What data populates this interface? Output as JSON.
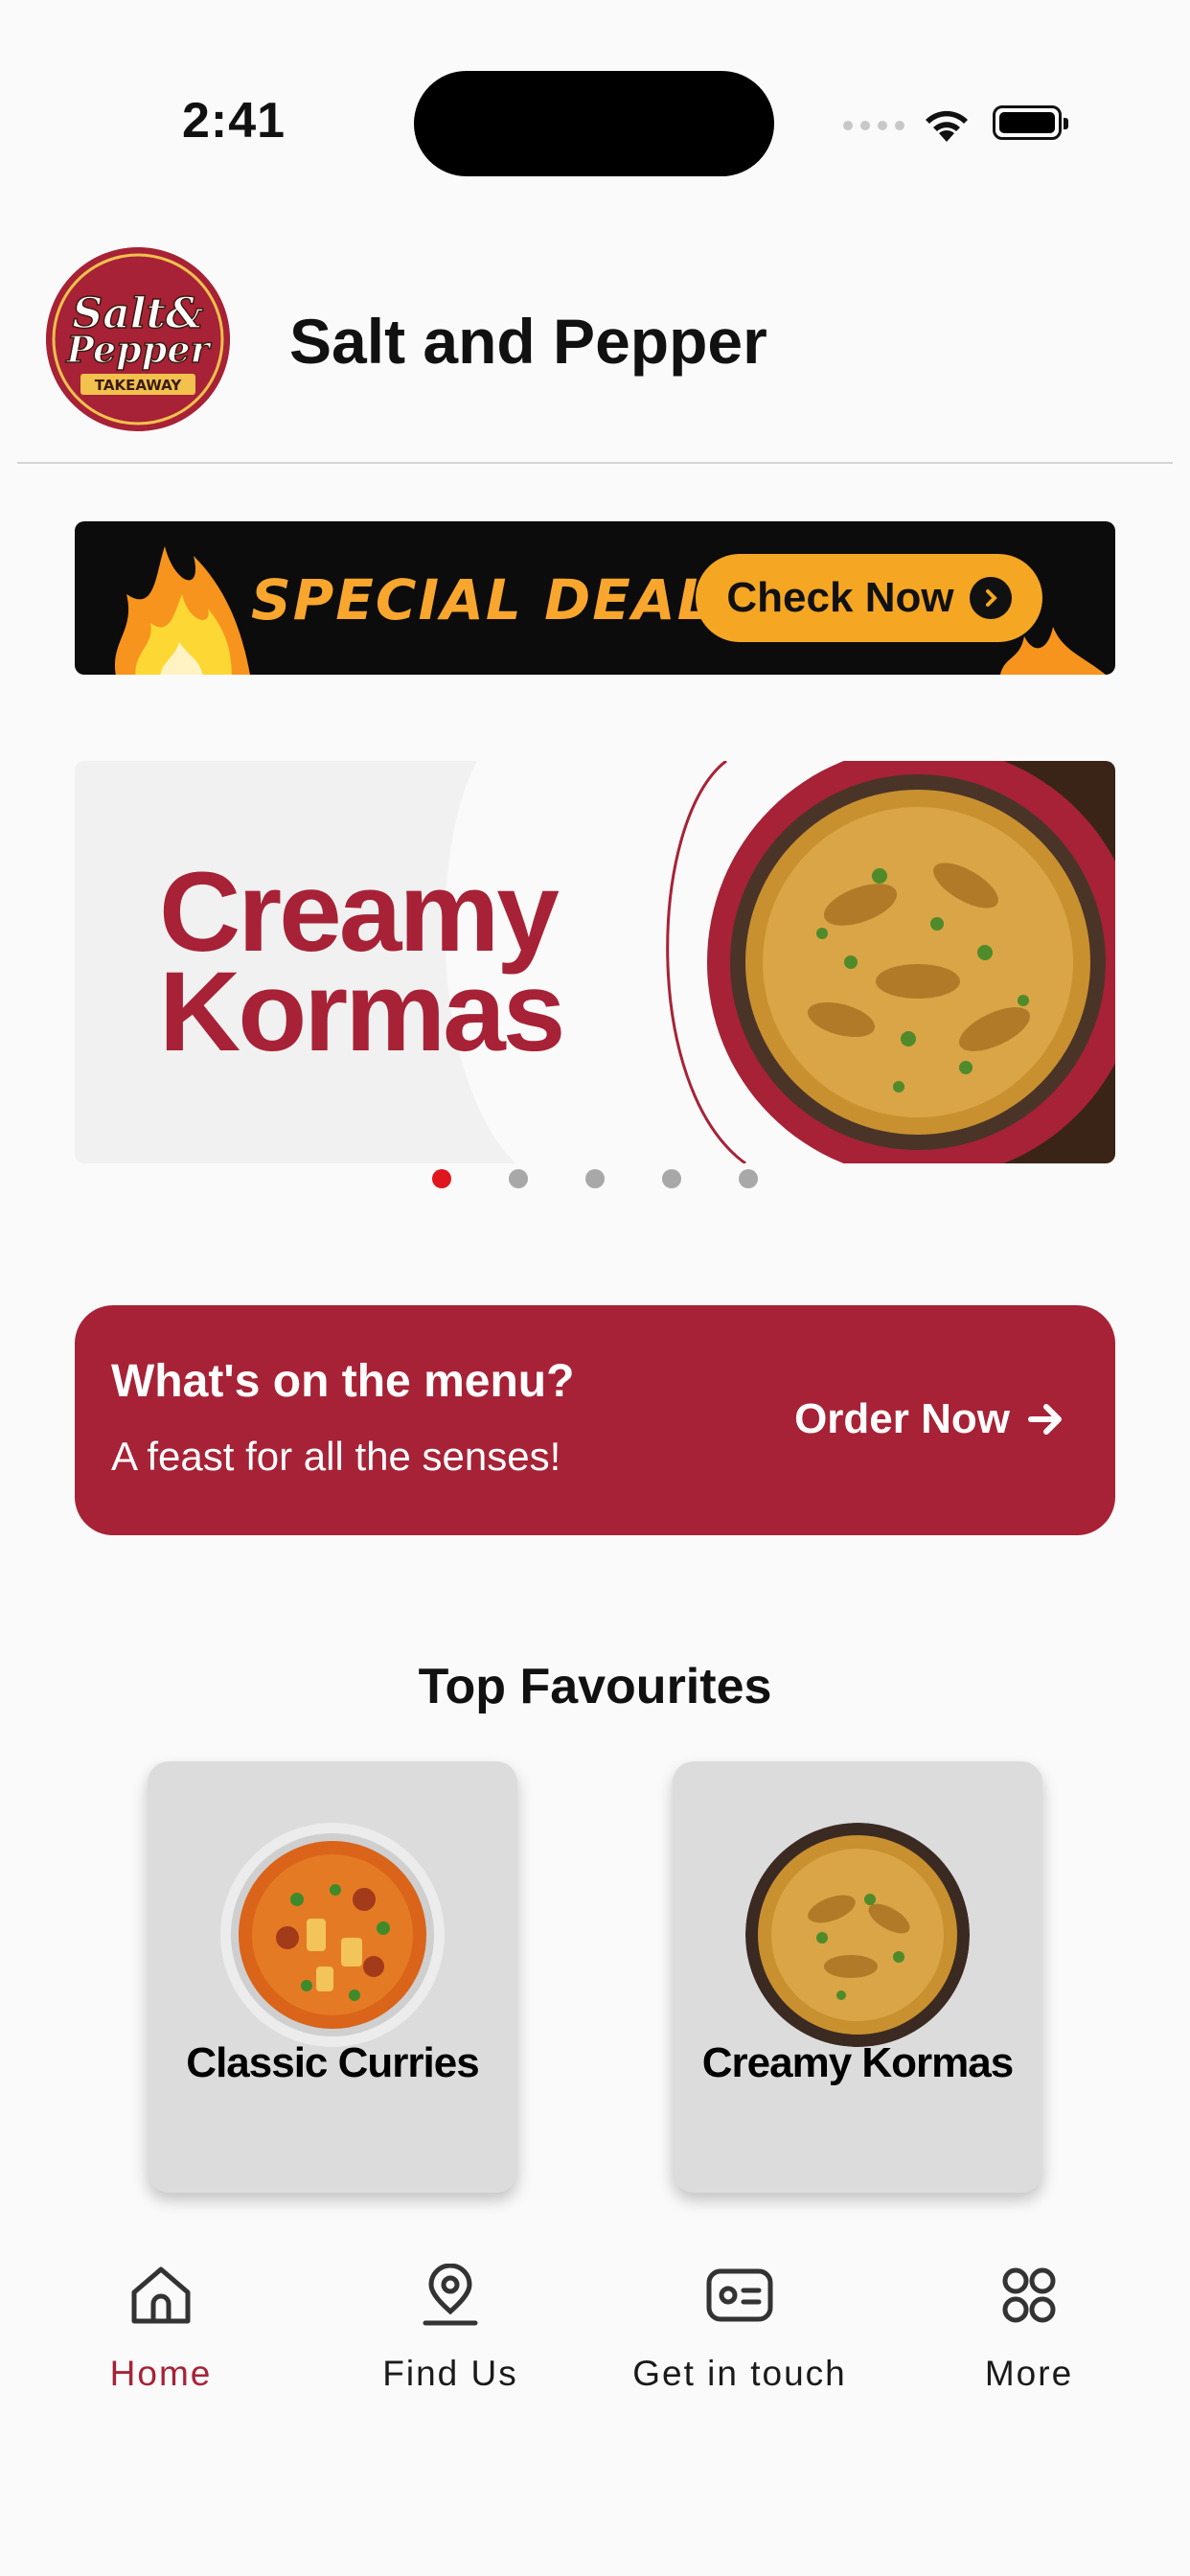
{
  "status_bar": {
    "time": "2:41"
  },
  "header": {
    "logo_text": {
      "line1": "Salt&",
      "line2": "Pepper",
      "line3": "TAKEAWAY"
    },
    "title": "Salt and Pepper"
  },
  "deals_banner": {
    "text": "SPECIAL DEALS",
    "button_label": "Check Now"
  },
  "carousel": {
    "slide_title": "Creamy Kormas",
    "dot_count": 5,
    "active_index": 0
  },
  "menu_cta": {
    "title": "What's on the menu?",
    "subtitle": "A feast for all the senses!",
    "button_label": "Order Now"
  },
  "favourites": {
    "heading": "Top Favourites",
    "items": [
      {
        "label": "Classic Curries"
      },
      {
        "label": "Creamy Kormas"
      }
    ]
  },
  "tabbar": {
    "items": [
      {
        "label": "Home",
        "icon": "home-icon",
        "active": true
      },
      {
        "label": "Find Us",
        "icon": "location-pin-icon",
        "active": false
      },
      {
        "label": "Get in touch",
        "icon": "contact-card-icon",
        "active": false
      },
      {
        "label": "More",
        "icon": "grid-icon",
        "active": false
      }
    ]
  },
  "colors": {
    "brand": "#a72236",
    "accent": "#f5a623",
    "active_dot": "#e0161e"
  }
}
